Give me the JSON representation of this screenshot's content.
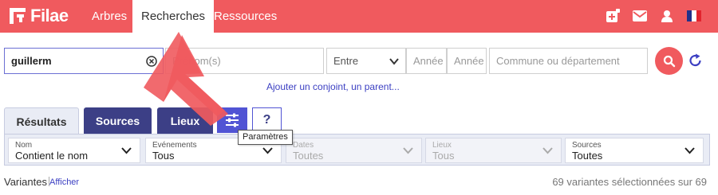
{
  "brand": {
    "name": "Filae"
  },
  "nav": {
    "items": [
      {
        "label": "Arbres"
      },
      {
        "label": "Recherches"
      },
      {
        "label": "Ressources"
      }
    ]
  },
  "topbar_icons": [
    "add-tree-icon",
    "mail-icon",
    "user-icon",
    "french-flag-icon"
  ],
  "search": {
    "name_value": "guillerm",
    "firstname_placeholder": "Prénom(s)",
    "period_select": "Entre",
    "year_from_placeholder": "Année",
    "year_to_placeholder": "Année",
    "place_placeholder": "Commune ou département"
  },
  "add_link": "Ajouter un conjoint, un parent...",
  "tabs": {
    "results": "Résultats",
    "sources": "Sources",
    "lieux": "Lieux",
    "help": "?"
  },
  "tooltip": "Paramètres",
  "filters": [
    {
      "label": "Nom",
      "value": "Contient le nom"
    },
    {
      "label": "Evénements",
      "value": "Tous"
    },
    {
      "label": "Dates",
      "value": "Toutes"
    },
    {
      "label": "Lieux",
      "value": "Tous"
    },
    {
      "label": "Sources",
      "value": "Toutes"
    }
  ],
  "footer": {
    "variants_label": "Variantes",
    "afficher_link": "Afficher",
    "selected_text": "69 variantes sélectionnées sur 69"
  },
  "colors": {
    "brand_red": "#f05a5e",
    "navy": "#3c3f86",
    "indigo": "#5154d4",
    "link": "#3b3fc2"
  }
}
